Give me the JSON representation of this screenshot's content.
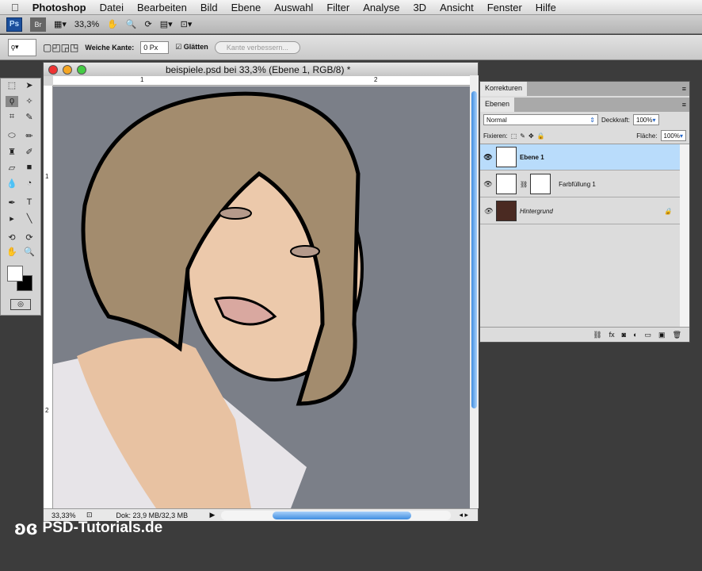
{
  "menubar": {
    "app": "Photoshop",
    "items": [
      "Datei",
      "Bearbeiten",
      "Bild",
      "Ebene",
      "Auswahl",
      "Filter",
      "Analyse",
      "3D",
      "Ansicht",
      "Fenster",
      "Hilfe"
    ]
  },
  "appbar": {
    "ps": "Ps",
    "br": "Br",
    "zoom": "33,3%"
  },
  "options": {
    "feather_label": "Weiche Kante:",
    "feather_value": "0 Px",
    "smooth_label": "Glätten",
    "refine_label": "Kante verbessern..."
  },
  "document": {
    "title": "beispiele.psd bei 33,3% (Ebene 1, RGB/8) *",
    "ruler_top": [
      "1",
      "2"
    ],
    "ruler_left": [
      "1",
      "2"
    ],
    "zoom": "33,33%",
    "doc_info": "Dok: 23,9 MB/32,3 MB"
  },
  "panel": {
    "tab_adjust": "Korrekturen",
    "tab_layers": "Ebenen",
    "blend_mode": "Normal",
    "opacity_label": "Deckkraft:",
    "opacity": "100%",
    "lock_label": "Fixieren:",
    "fill_label": "Fläche:",
    "fill": "100%",
    "layers": [
      {
        "name": "Ebene 1",
        "selected": true
      },
      {
        "name": "Farbfüllung 1"
      },
      {
        "name": "Hintergrund",
        "locked": true
      }
    ]
  },
  "watermark": "PSD-Tutorials.de"
}
